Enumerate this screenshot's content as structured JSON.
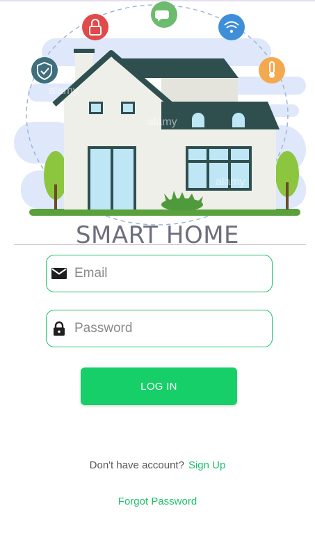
{
  "brand": {
    "title": "SMART HOME"
  },
  "illustration": {
    "watermark": "alamy",
    "feature_icons": [
      "shield-check-icon",
      "lock-icon",
      "chat-bubble-icon",
      "wifi-icon",
      "thermometer-icon"
    ]
  },
  "form": {
    "email_placeholder": "Email",
    "email_value": "",
    "password_placeholder": "Password",
    "password_value": "",
    "login_label": "LOG IN"
  },
  "footer": {
    "no_account_text": "Don't have account?",
    "signup_label": "Sign Up",
    "forgot_label": "Forgot Password"
  },
  "colors": {
    "accent": "#16cf68",
    "roof": "#2f4f4f",
    "wall": "#efefe9"
  }
}
